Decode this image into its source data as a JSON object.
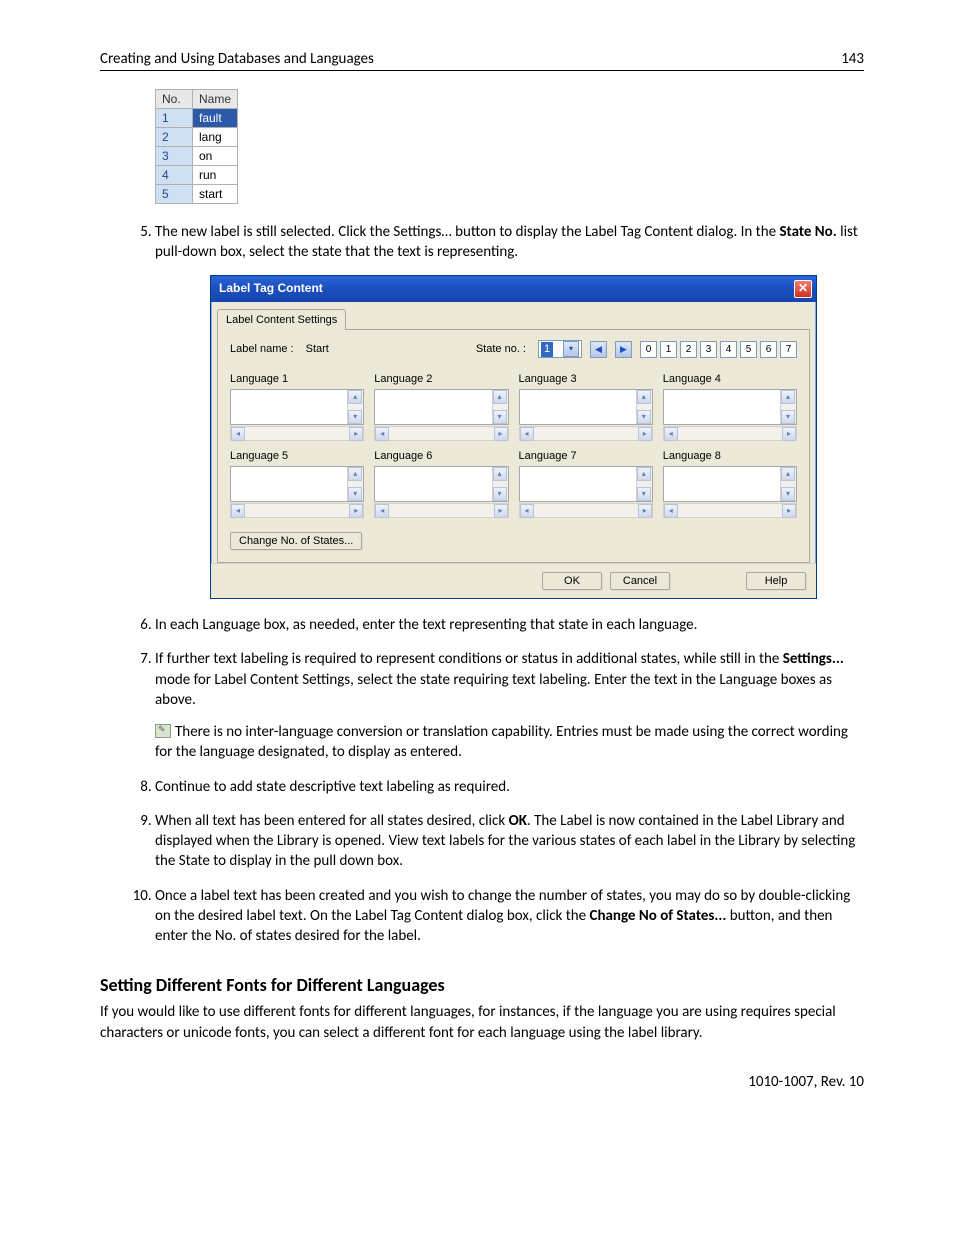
{
  "header": {
    "title": "Creating and Using Databases and Languages",
    "page": "143"
  },
  "table": {
    "headers": [
      "No.",
      "Name"
    ],
    "rows": [
      {
        "no": "1",
        "name": "fault",
        "selected": true
      },
      {
        "no": "2",
        "name": "lang"
      },
      {
        "no": "3",
        "name": "on"
      },
      {
        "no": "4",
        "name": "run"
      },
      {
        "no": "5",
        "name": "start"
      }
    ]
  },
  "steps": {
    "s5a": "The new label is still selected. Click the Settings… button to display the Label Tag Content dialog. In the ",
    "s5b": "State No.",
    "s5c": " list pull-down box, select the state that the text is representing.",
    "s6": "In each Language box, as needed, enter the text representing that state in each language.",
    "s7a": "If further text labeling is required to represent conditions or status in additional states, while still in the ",
    "s7b": "Settings...",
    "s7c": " mode for Label Content Settings, select the state requiring text labeling. Enter the text in the Language boxes as above.",
    "s7note": "There is no inter-language conversion or translation capability. Entries must be made using the correct wording for the language designated, to display as entered.",
    "s8": "Continue to add state descriptive text labeling as required.",
    "s9a": "When all text has been entered for all states desired, click ",
    "s9b": "OK",
    "s9c": ". The Label is now contained in the Label Library and displayed when the Library is opened. View text labels for the various states of each label in the Library by selecting the State to display in the pull down box.",
    "s10a": "Once a label text has been created and you wish to change the number of states, you may do so by double-clicking on the desired label text. On the Label Tag Content dialog box, click the ",
    "s10b": "Change No of States...",
    "s10c": " button, and then enter the No. of states desired for the label."
  },
  "dialog": {
    "title": "Label Tag Content",
    "tab": "Label Content Settings",
    "labelname_label": "Label name :",
    "labelname_value": "Start",
    "stateno_label": "State no. :",
    "stateno_value": "1",
    "nums": [
      "0",
      "1",
      "2",
      "3",
      "4",
      "5",
      "6",
      "7"
    ],
    "langs": [
      "Language 1",
      "Language 2",
      "Language 3",
      "Language 4",
      "Language 5",
      "Language 6",
      "Language 7",
      "Language 8"
    ],
    "change_btn": "Change No. of States...",
    "ok": "OK",
    "cancel": "Cancel",
    "help": "Help"
  },
  "section_heading": "Setting Different Fonts for Different Languages",
  "section_body": "If you would like to use different fonts for different languages, for instances, if the language you are using requires special characters or unicode fonts, you can select a different font for each language using the label library.",
  "footer": "1010-1007, Rev. 10"
}
